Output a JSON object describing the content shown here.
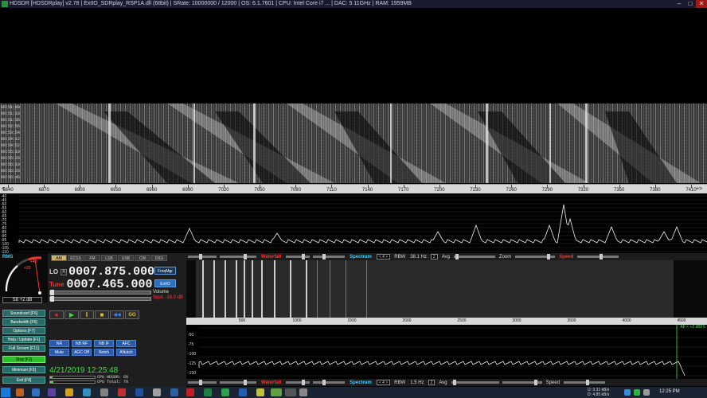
{
  "titlebar": {
    "text": "HDSDR  [HDSDRplay]  v2.78  |  ExtIO_SDRplay_RSP1A.dll (68bit)  |  SRate: 10000000 / 12000  |  OS: 6.1.7601  |  CPU: Intel Core i7 ...  |  DAC: 5 11GHz  |  RAM: 1959MB",
    "minimize": "–",
    "maximize": "□",
    "close": "✕"
  },
  "waterfall_times": [
    "06:51:00",
    "06:51:18",
    "06:51:36",
    "06:52:56",
    "06:53:54",
    "06:54:12",
    "06:54:52",
    "06:55:10",
    "06:55:28",
    "06:56:10",
    "06:56:28",
    "06:56:46"
  ],
  "freq_scale": {
    "labels": [
      "6840",
      "6870",
      "6900",
      "6930",
      "6960",
      "6990",
      "7020",
      "7050",
      "7080",
      "7110",
      "7140",
      "7170",
      "7200",
      "7230",
      "7260",
      "7290",
      "7320",
      "7350",
      "7380",
      "7410"
    ],
    "left_arrow": "<",
    "right_arrow": "+>"
  },
  "spectrum_db": [
    "-40",
    "-45",
    "-50",
    "-55",
    "-60",
    "-65",
    "-70",
    "-75",
    "-80",
    "-85",
    "-90",
    "-95",
    "-100",
    "-105",
    "-110"
  ],
  "strip": {
    "waterfall": "Waterfall",
    "spectrum": "Spectrum",
    "rbw_label": "RBW",
    "rbw_value": "38.1 Hz",
    "avg_combo": "2",
    "avg": "Avg",
    "zoom": "Zoom",
    "speed": "Speed",
    "pct": "< 4 >"
  },
  "strip2": {
    "rbw_value": "1.5 Hz",
    "avg_combo": "2"
  },
  "smeter": {
    "rms": "RMS",
    "value": "S8 +2 dB",
    "scale_plus": "+40",
    "scale_plus2": "+20"
  },
  "modes": [
    "AM",
    "ECSS",
    "FM",
    "LSB",
    "USB",
    "CW",
    "DIGI"
  ],
  "lo": {
    "tag": "LO",
    "ab": "A",
    "value": "0007.875.000"
  },
  "tune": {
    "tag": "Tune",
    "value": "0007.465.000"
  },
  "side_buttons": {
    "freq_mgr": "FreqMgr",
    "extio": "ExtIO"
  },
  "volume_label": "Volume",
  "squelch_label": "Squl: -16.0 dB",
  "transport": [
    "●",
    "▶",
    "‖",
    "■",
    "◀◀",
    "GO"
  ],
  "function_buttons": [
    "Soundcard  [F5]",
    "Bandwidth  [F6]",
    "Options  [F7]",
    "Help / Update  [F1]",
    "Full Screen  [F11]",
    "Stop  [F2]",
    "Minimize  [F3]",
    "Exit  [F4]"
  ],
  "dsp_row1": [
    "NR",
    "NB RF",
    "NB IF",
    "AFC"
  ],
  "dsp_row2": [
    "Mute",
    "AGC Off",
    "Notch",
    "ANotch"
  ],
  "clock": "4/21/2019 12:25:48",
  "cpu": {
    "hdsdr": "CPU HDSDR:  6%",
    "total": "CPU Total:  7%",
    "hdsdr_pct": 0.06,
    "total_pct": 0.07
  },
  "audio_scale": [
    "500",
    "1000",
    "1500",
    "2000",
    "2500",
    "3000",
    "3500",
    "4000",
    "4500"
  ],
  "audio_db": [
    "-50",
    "-75",
    "-100",
    "-125",
    "-150"
  ],
  "af_label": "AF < +2 dBFS",
  "taskbar": {
    "net_up": "U:   3.31 kB/s",
    "net_down": "D:   4.85 kB/s",
    "time": "12:25 PM"
  }
}
